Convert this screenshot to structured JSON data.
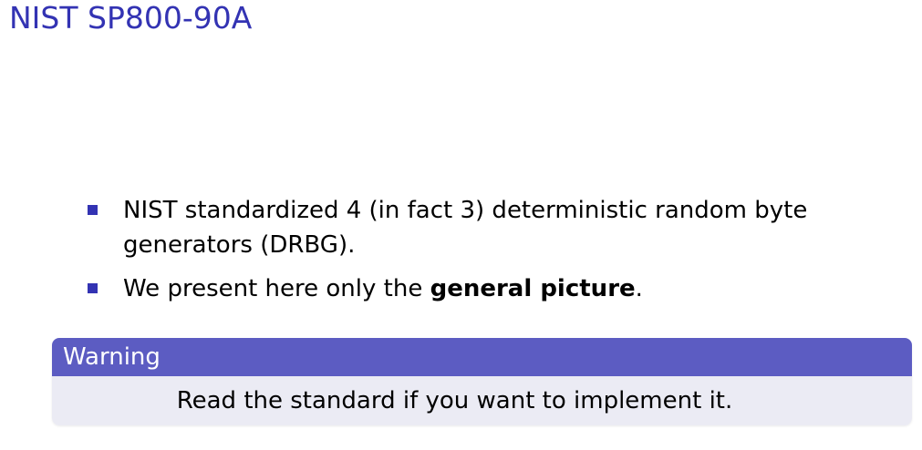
{
  "slide": {
    "title": "NIST SP800-90A"
  },
  "bullets": [
    {
      "text": "NIST standardized 4 (in fact 3) deterministic random byte generators (DRBG)."
    },
    {
      "prefix": "We present here only the ",
      "emphasis": "general picture",
      "suffix": "."
    }
  ],
  "warning": {
    "title": "Warning",
    "body": "Read the standard if you want to implement it."
  },
  "colors": {
    "title": "#3333b3",
    "bullet_marker": "#3333b3",
    "block_header": "#5c5cc2",
    "block_body": "#ebebf4"
  }
}
